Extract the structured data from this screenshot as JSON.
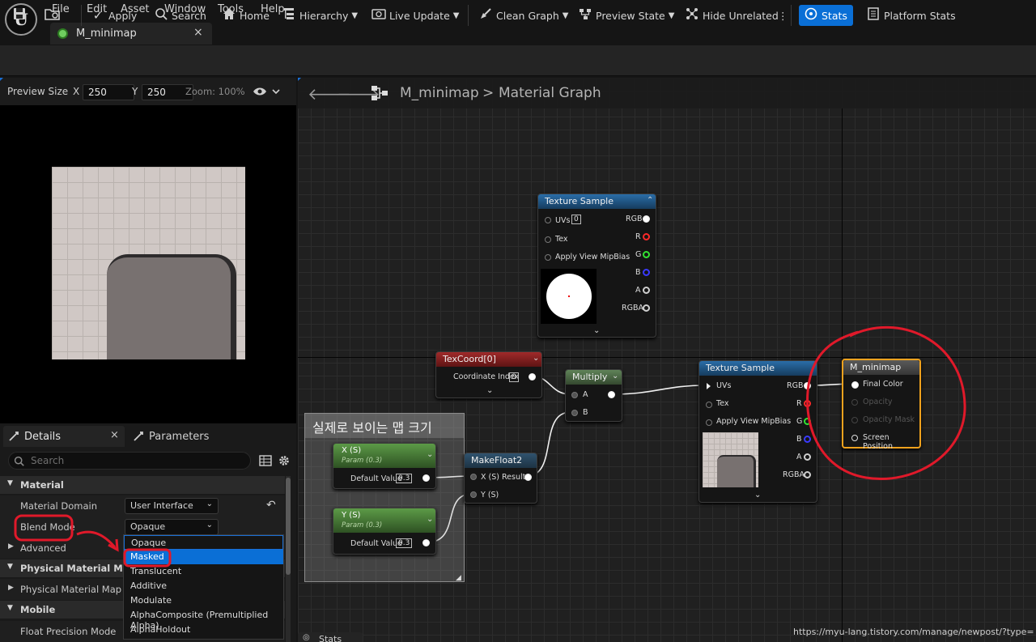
{
  "menubar": {
    "logo": "U",
    "items": [
      "File",
      "Edit",
      "Asset",
      "Window",
      "Tools",
      "Help"
    ]
  },
  "doc_tab": {
    "label": "M_minimap",
    "close": "×"
  },
  "toolbar": {
    "save_icon": "save-icon",
    "browse_icon": "browse-icon",
    "apply": "Apply",
    "search": "Search",
    "home": "Home",
    "hierarchy": "Hierarchy",
    "live_update": "Live Update",
    "clean_graph": "Clean Graph",
    "preview_state": "Preview State",
    "hide_unrelated": "Hide Unrelated",
    "more": "⋮",
    "stats": "Stats",
    "platform_stats": "Platform Stats",
    "stats_color": "#0a6fd6"
  },
  "preview": {
    "size_label": "Preview Size",
    "x_label": "X",
    "x_value": "250",
    "y_label": "Y",
    "y_value": "250",
    "zoom": "Zoom: 100%"
  },
  "details": {
    "tab_details": "Details",
    "tab_parameters": "Parameters",
    "close": "×",
    "search_placeholder": "Search",
    "cat_material": "Material",
    "material_domain_label": "Material Domain",
    "material_domain_value": "User Interface",
    "blend_mode_label": "Blend Mode",
    "blend_mode_value": "Opaque",
    "advanced_label": "Advanced",
    "cat_physical_mask": "Physical Material Mask",
    "physical_map_label": "Physical Material Map",
    "cat_mobile": "Mobile",
    "float_precision_label": "Float Precision Mode",
    "dropdown_options": [
      "Opaque",
      "Masked",
      "Translucent",
      "Additive",
      "Modulate",
      "AlphaComposite (Premultiplied Alpha)",
      "AlphaHoldout"
    ],
    "dropdown_selected": "Masked"
  },
  "graph": {
    "breadcrumb_asset": "M_minimap",
    "breadcrumb_sep": ">",
    "breadcrumb_view": "Material Graph",
    "comment_text": "실제로 보이는 맵 크기",
    "ts1": {
      "title": "Texture Sample",
      "in_uvs": "UVs",
      "uvs_value": "0",
      "in_tex": "Tex",
      "in_mip": "Apply View MipBias",
      "out_rgb": "RGB",
      "out_r": "R",
      "out_g": "G",
      "out_b": "B",
      "out_a": "A",
      "out_rgba": "RGBA"
    },
    "texcoord": {
      "title": "TexCoord[0]",
      "coord_label": "Coordinate Index",
      "coord_value": "0"
    },
    "multiply": {
      "title": "Multiply",
      "in_a": "A",
      "in_b": "B"
    },
    "makefloat2": {
      "title": "MakeFloat2",
      "in_x": "X (S)",
      "in_y": "Y (S)",
      "out_result": "Result"
    },
    "param_x": {
      "title": "X (S)",
      "subtitle": "Param (0.3)",
      "label": "Default Value",
      "value": "0.3"
    },
    "param_y": {
      "title": "Y (S)",
      "subtitle": "Param (0.3)",
      "label": "Default Value",
      "value": "0.3"
    },
    "ts2": {
      "title": "Texture Sample",
      "in_uvs": "UVs",
      "in_tex": "Tex",
      "in_mip": "Apply View MipBias",
      "out_rgb": "RGB",
      "out_r": "R",
      "out_g": "G",
      "out_b": "B",
      "out_a": "A",
      "out_rgba": "RGBA"
    },
    "result": {
      "title": "M_minimap",
      "final_color": "Final Color",
      "opacity": "Opacity",
      "opacity_mask": "Opacity Mask",
      "screen_position": "Screen Position"
    }
  },
  "bottom": {
    "stats_tab": "Stats",
    "url": "https://myu-lang.tistory.com/manage/newpost/?type="
  },
  "colors": {
    "annotation_red": "#e0192a",
    "result_border": "#f0a21e",
    "texture_header": "#205a8c",
    "texcoord_header": "#8c1d1d",
    "multiply_header": "#4d6b45",
    "param_header": "#4e8a3a"
  }
}
